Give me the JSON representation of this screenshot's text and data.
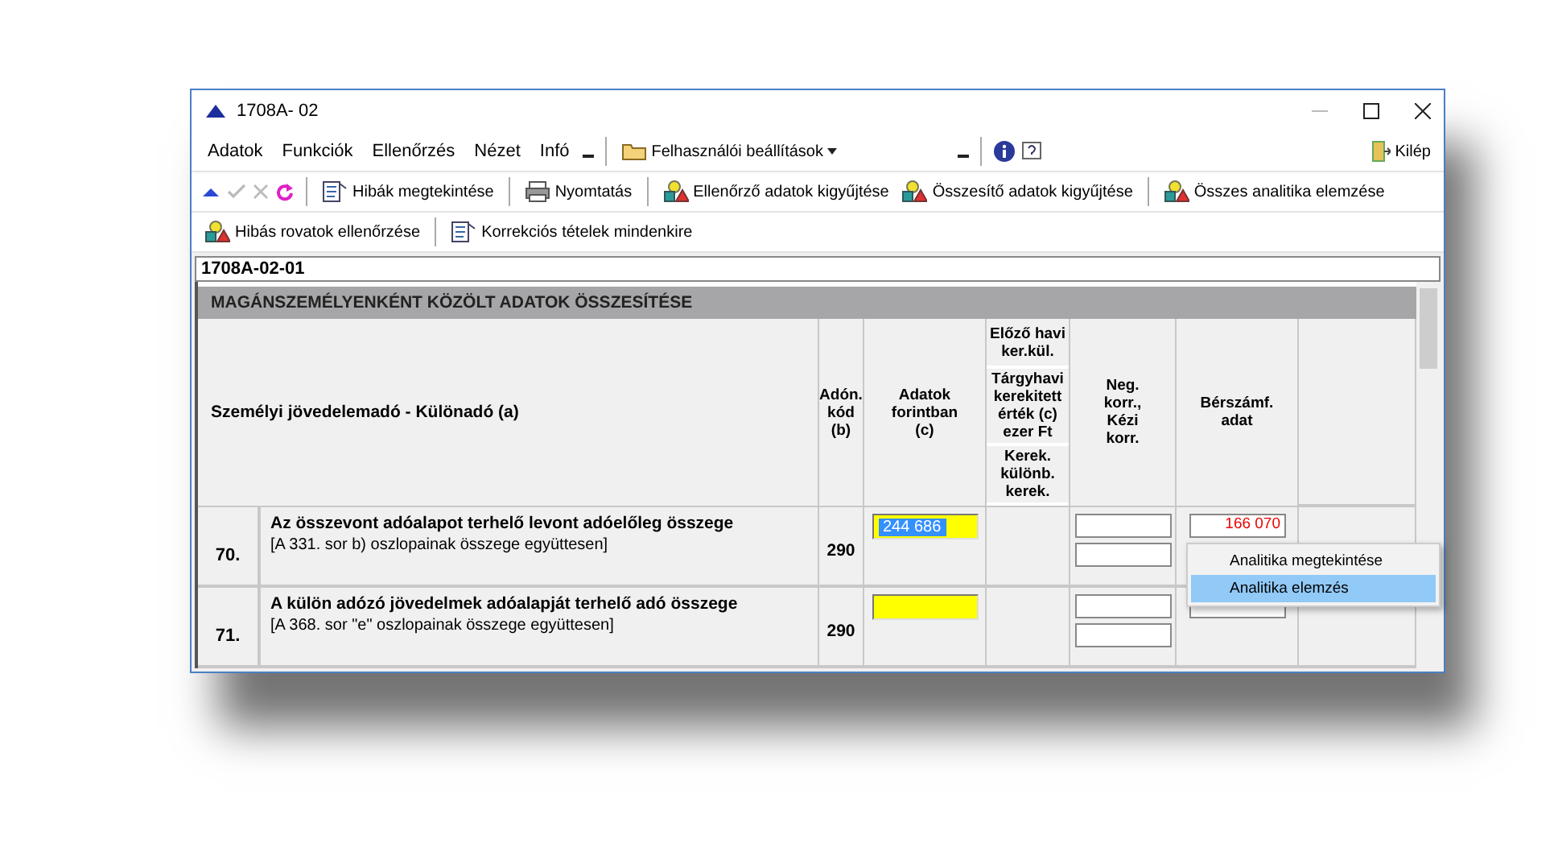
{
  "window": {
    "title": "1708A- 02"
  },
  "menu": [
    "Adatok",
    "Funkciók",
    "Ellenőrzés",
    "Nézet",
    "Infó"
  ],
  "settings_menu": "Felhasználói beállítások",
  "exit": "Kilép",
  "toolbar": [
    [
      {
        "kind": "up",
        "disabled": false
      },
      {
        "kind": "check",
        "disabled": true
      },
      {
        "kind": "cancel",
        "disabled": true
      },
      {
        "kind": "refresh",
        "disabled": false
      }
    ],
    [
      {
        "kind": "doc",
        "label": "Hibák megtekintése"
      }
    ],
    [
      {
        "kind": "printer",
        "label": "Nyomtatás"
      }
    ],
    [
      {
        "kind": "shapes",
        "label": "Ellenőrző adatok kigyűjtése"
      },
      {
        "kind": "shapes",
        "label": "Összesítő adatok kigyűjtése"
      }
    ],
    [
      {
        "kind": "shapes",
        "label": "Összes analitika elemzése"
      }
    ]
  ],
  "toolbar2": [
    [
      {
        "kind": "shapes",
        "label": "Hibás rovatok ellenőrzése"
      }
    ],
    [
      {
        "kind": "doc",
        "label": "Korrekciós tételek mindenkire"
      }
    ]
  ],
  "form_id": "1708A-02-01",
  "section_title": "MAGÁNSZEMÉLYENKÉNT KÖZÖLT ADATOK ÖSSZESÍTÉSE",
  "table": {
    "header": {
      "label": "Személyi jövedelemadó - Különadó (a)",
      "code": "Adón.\nkód\n(b)",
      "amount": "Adatok\nforintban\n(c)",
      "rounding": [
        "Előző havi\nker.kül.",
        "Tárgyhavi\nkerekitett\nérték (c)\nezer Ft",
        "Kerek.\nkülönb.\nkerek."
      ],
      "neg": "Neg.\nkorr.,\nKézi\nkorr.",
      "payroll": "Bérszámf.\nadat"
    },
    "rows": [
      {
        "number": "70.",
        "title": "Az összevont adóalapot terhelő levont adóelőleg összege",
        "subtitle": "[A 331. sor b) oszlopainak összege együttesen]",
        "code": "290",
        "amount": {
          "value": "244 686",
          "selected": true
        },
        "payroll": {
          "value": "166 070",
          "error": true
        },
        "context_menu": [
          {
            "label": "Analitika megtekintése",
            "selected": false
          },
          {
            "label": "Analitika elemzés",
            "selected": true
          }
        ]
      },
      {
        "number": "71.",
        "title": "A külön adózó jövedelmek adóalapját terhelő adó összege",
        "subtitle": "[A 368. sor \"e\" oszlopainak összege együttesen]",
        "code": "290",
        "amount": {}
      }
    ]
  }
}
